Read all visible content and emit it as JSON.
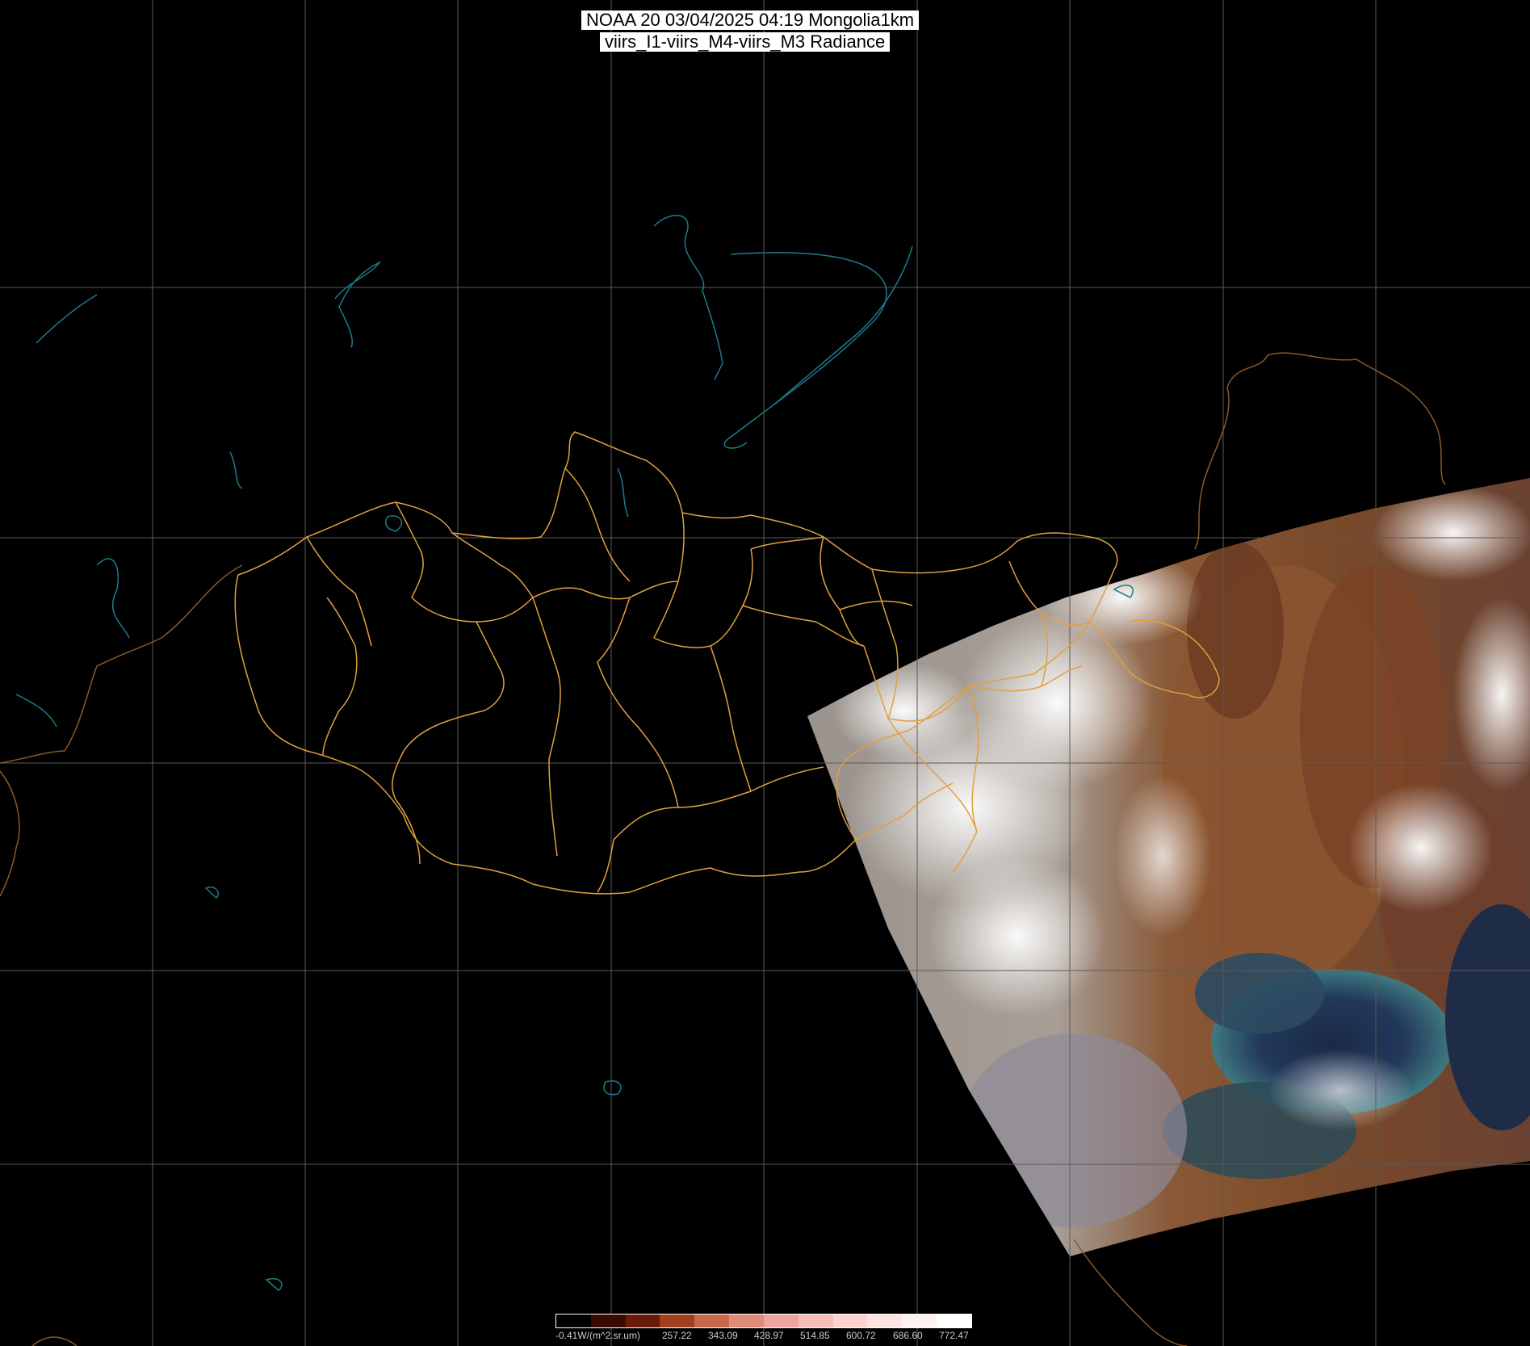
{
  "title": {
    "line1": "NOAA 20 03/04/2025 04:19 Mongolia1km",
    "line2": "viirs_I1-viirs_M4-viirs_M3 Radiance"
  },
  "colors": {
    "background": "#000000",
    "grid": "#5a5a5a",
    "admin_boundaries": "#e0a040",
    "water_outline": "#1f7a8c",
    "country_border_outside": "#8a5a2a"
  },
  "colorbar": {
    "unit_label": "-0.41W/(m^2.sr.um)",
    "ticks": [
      "257.22",
      "343.09",
      "428.97",
      "514.85",
      "600.72",
      "686.60",
      "772.47"
    ],
    "swatches": [
      "#000000",
      "#3a0a00",
      "#6a1a08",
      "#a0401c",
      "#c8684a",
      "#e08a78",
      "#f0a4a0",
      "#f6bcb8",
      "#fad2d0",
      "#fce4e2",
      "#fef2f0",
      "#ffffff"
    ]
  },
  "layers": {
    "imagery": "VIIRS true-color swath over northern China, Korea, Bohai Sea",
    "boundaries": "Mongolia aimag boundaries"
  }
}
